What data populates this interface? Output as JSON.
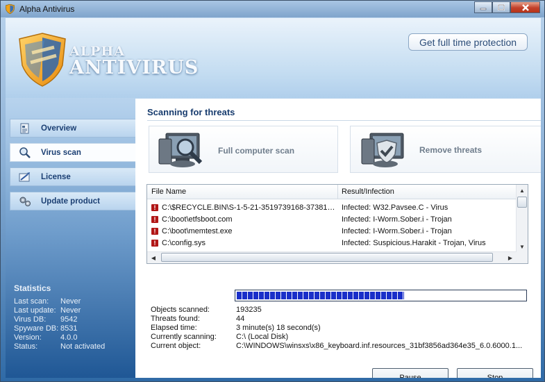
{
  "window": {
    "title": "Alpha Antivirus"
  },
  "header": {
    "logo_line1": "ALPHA",
    "logo_line2": "ANTIVIRUS",
    "protect_button": "Get full time protection"
  },
  "nav": {
    "items": [
      {
        "label": "Overview",
        "icon": "overview-icon"
      },
      {
        "label": "Virus scan",
        "icon": "magnifier-icon"
      },
      {
        "label": "License",
        "icon": "license-icon"
      },
      {
        "label": "Update product",
        "icon": "gears-icon"
      }
    ],
    "active": "Virus scan"
  },
  "statistics": {
    "title": "Statistics",
    "rows": [
      {
        "label": "Last scan:",
        "value": "Never"
      },
      {
        "label": "Last update:",
        "value": "Never"
      },
      {
        "label": "Virus DB:",
        "value": "9542"
      },
      {
        "label": "Spyware DB:",
        "value": "8531"
      },
      {
        "label": "Version:",
        "value": "4.0.0"
      },
      {
        "label": "Status:",
        "value": "Not activated"
      }
    ]
  },
  "scan": {
    "title": "Scanning for threats",
    "actions": [
      {
        "label": "Full computer scan"
      },
      {
        "label": "Remove threats"
      }
    ],
    "columns": [
      "File Name",
      "Result/Infection"
    ],
    "rows": [
      {
        "file": "C:\\$RECYCLE.BIN\\S-1-5-21-3519739168-373817...",
        "result": "Infected: W32.Pavsee.C - Virus"
      },
      {
        "file": "C:\\boot\\etfsboot.com",
        "result": "Infected: I-Worm.Sober.i - Trojan"
      },
      {
        "file": "C:\\boot\\memtest.exe",
        "result": "Infected: I-Worm.Sober.i - Trojan"
      },
      {
        "file": "C:\\config.sys",
        "result": "Infected: Suspicious.Harakit - Trojan, Virus"
      }
    ],
    "progress_percent": 58,
    "info": [
      {
        "label": "Objects scanned:",
        "value": "193235"
      },
      {
        "label": "Threats found:",
        "value": "44"
      },
      {
        "label": "Elapsed time:",
        "value": "3 minute(s) 18 second(s)"
      },
      {
        "label": "Currently scanning:",
        "value": "C:\\ (Local Disk)"
      },
      {
        "label": "Current object:",
        "value": "C:\\WINDOWS\\winsxs\\x86_keyboard.inf.resources_31bf3856ad364e35_6.0.6000.1..."
      }
    ],
    "pause_label": "Pause",
    "stop_label": "Stop"
  }
}
